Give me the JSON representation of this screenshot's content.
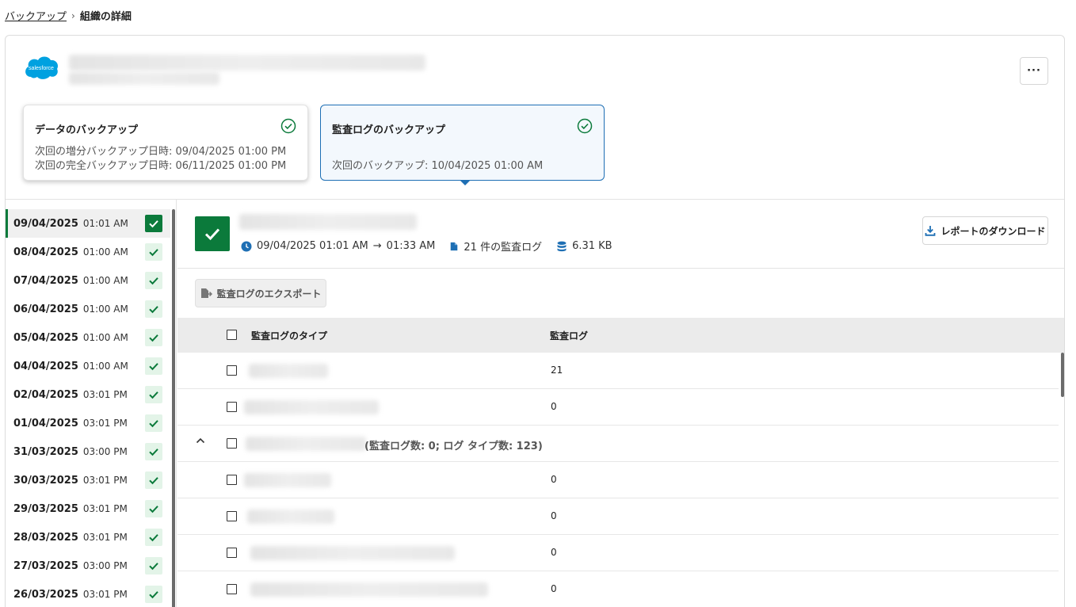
{
  "breadcrumb": {
    "parent": "バックアップ",
    "current": "組織の詳細"
  },
  "org": {
    "logo_text": "salesforce",
    "more_label": "···"
  },
  "cards": {
    "data": {
      "title": "データのバックアップ",
      "line1": "次回の増分バックアップ日時: 09/04/2025 01:00 PM",
      "line2": "次回の完全バックアップ日時: 06/11/2025 01:00 PM"
    },
    "audit": {
      "title": "監査ログのバックアップ",
      "line1": "次回のバックアップ: 10/04/2025 01:00 AM"
    }
  },
  "dates": [
    {
      "date": "09/04/2025",
      "time": "01:01 AM"
    },
    {
      "date": "08/04/2025",
      "time": "01:00 AM"
    },
    {
      "date": "07/04/2025",
      "time": "01:00 AM"
    },
    {
      "date": "06/04/2025",
      "time": "01:00 AM"
    },
    {
      "date": "05/04/2025",
      "time": "01:00 AM"
    },
    {
      "date": "04/04/2025",
      "time": "01:00 AM"
    },
    {
      "date": "02/04/2025",
      "time": "03:01 PM"
    },
    {
      "date": "01/04/2025",
      "time": "03:01 PM"
    },
    {
      "date": "31/03/2025",
      "time": "03:00 PM"
    },
    {
      "date": "30/03/2025",
      "time": "03:01 PM"
    },
    {
      "date": "29/03/2025",
      "time": "03:01 PM"
    },
    {
      "date": "28/03/2025",
      "time": "03:01 PM"
    },
    {
      "date": "27/03/2025",
      "time": "03:00 PM"
    },
    {
      "date": "26/03/2025",
      "time": "03:01 PM"
    }
  ],
  "run": {
    "start": "09/04/2025 01:01 AM",
    "end": "01:33 AM",
    "logs": "21 件の監査ログ",
    "size": "6.31 KB"
  },
  "buttons": {
    "download": "レポートのダウンロード",
    "export": "監査ログのエクスポート"
  },
  "table": {
    "col_type": "監査ログのタイプ",
    "col_log": "監査ログ",
    "rows": [
      {
        "value": "21"
      },
      {
        "value": "0"
      },
      {
        "group_label": "(監査ログ数: 0; ログ タイプ数: 123)"
      },
      {
        "value": "0"
      },
      {
        "value": "0"
      },
      {
        "value": "0"
      },
      {
        "value": "0"
      }
    ]
  },
  "colors": {
    "accent": "#0b7a3b",
    "selected_border": "#1e6fb4"
  }
}
